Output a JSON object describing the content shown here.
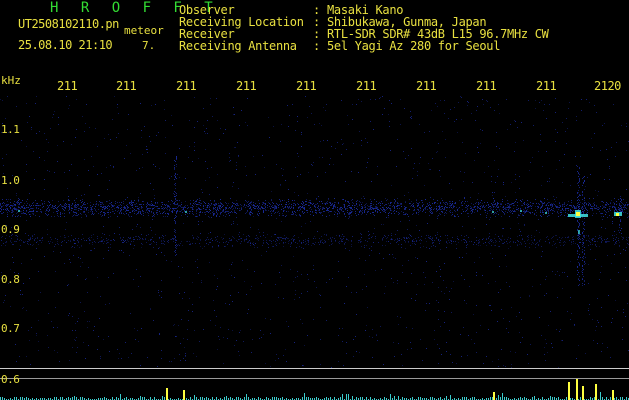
{
  "header": {
    "app_title": "H R O F F T",
    "filename": "UT2508102110.pn",
    "event_label": "meteor",
    "timestamp": "25.08.10 21:10",
    "event_count": "7."
  },
  "metadata": [
    {
      "label": "Observer",
      "value": "Masaki Kano"
    },
    {
      "label": "Receiving Location",
      "value": "Shibukawa, Gunma, Japan"
    },
    {
      "label": "Receiver",
      "value": "RTL-SDR SDR# 43dB L15 96.7MHz CW"
    },
    {
      "label": "Receiving Antenna",
      "value": "5el Yagi Az 280 for Seoul"
    }
  ],
  "separator": ":",
  "freq_axis": {
    "unit": "kHz",
    "ticks": [
      "1.1",
      "1.0",
      "0.9",
      "0.8",
      "0.7",
      "0.6"
    ]
  },
  "time_axis": {
    "ticks": [
      "211",
      "211",
      "211",
      "211",
      "211",
      "211",
      "211",
      "211",
      "211",
      "2120"
    ]
  },
  "colors": {
    "text_green": "#33dd33",
    "text_yellow": "#e8e040",
    "background": "#000000",
    "noise_blue": "#1a2a9a",
    "signal_cyan": "#40e0e0",
    "signal_yellow": "#ffff40"
  }
}
